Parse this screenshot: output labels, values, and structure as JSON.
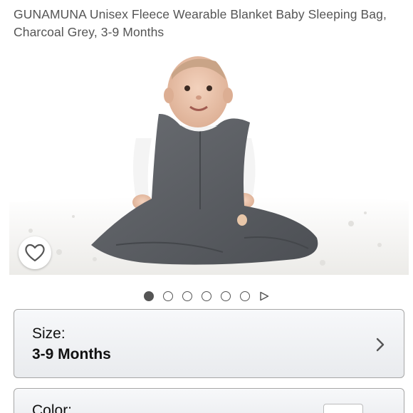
{
  "product": {
    "title": "GUNAMUNA Unisex Fleece Wearable Blanket Baby Sleeping Bag, Charcoal Grey, 3-9 Months"
  },
  "icons": {
    "share": "share-icon",
    "wishlist": "heart-icon",
    "chevron": "chevron-right-icon",
    "video": "play-icon"
  },
  "gallery": {
    "image_count": 6,
    "active_index": 0,
    "has_video": true
  },
  "options": {
    "size_label": "Size:",
    "size_value": "3-9 Months",
    "color_label": "Color:"
  },
  "colors": {
    "text": "#555555",
    "card_border": "#a6a6a6",
    "fabric": "#5a5d62"
  }
}
